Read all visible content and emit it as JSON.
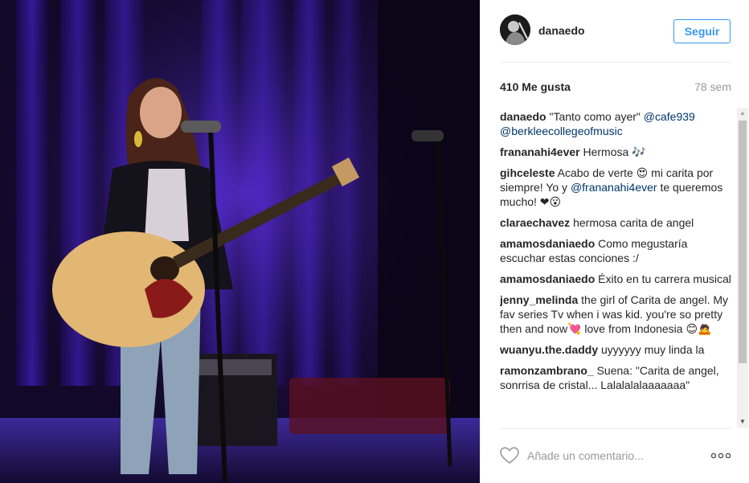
{
  "post": {
    "username": "danaedo",
    "follow_label": "Seguir",
    "likes": "410 Me gusta",
    "time_ago": "78 sem"
  },
  "comments": [
    {
      "user": "danaedo",
      "parts": [
        "\"Tanto como ayer\" ",
        "@cafe939",
        " ",
        "@berkleecollegeofmusic"
      ],
      "mentions": [
        1,
        3
      ]
    },
    {
      "user": "frananahi4ever",
      "parts": [
        "Hermosa 🎶"
      ],
      "mentions": []
    },
    {
      "user": "gihceleste",
      "parts": [
        "Acabo de verte 😍 mi carita por siempre! Yo y ",
        "@frananahi4ever",
        " te queremos mucho! ❤😮"
      ],
      "mentions": [
        1
      ]
    },
    {
      "user": "claraechavez",
      "parts": [
        "hermosa carita de angel"
      ],
      "mentions": []
    },
    {
      "user": "amamosdaniaedo",
      "parts": [
        "Como megustaría escuchar estas conciones :/"
      ],
      "mentions": []
    },
    {
      "user": "amamosdaniaedo",
      "parts": [
        "Éxito en tu carrera musical"
      ],
      "mentions": []
    },
    {
      "user": "jenny_melinda",
      "parts": [
        "the girl of Carita de angel. My fav series Tv when i was kid. you're so pretty then and now💘 love from Indonesia 😊🙇"
      ],
      "mentions": []
    },
    {
      "user": "wuanyu.the.daddy",
      "parts": [
        "uyyyyyy muy linda la"
      ],
      "mentions": []
    },
    {
      "user": "ramonzambrano_",
      "parts": [
        "Suena: \"Carita de angel, sonrrisa de cristal... Lalalalalaaaaaaa\""
      ],
      "mentions": []
    }
  ],
  "comment_box": {
    "placeholder": "Añade un comentario..."
  },
  "icons": {
    "like": "heart-icon",
    "options": "more-options-icon",
    "scroll_up": "scroll-up-arrow",
    "scroll_down": "scroll-down-arrow"
  },
  "colors": {
    "accent": "#3897f0",
    "mention": "#003569",
    "muted": "#999999"
  }
}
